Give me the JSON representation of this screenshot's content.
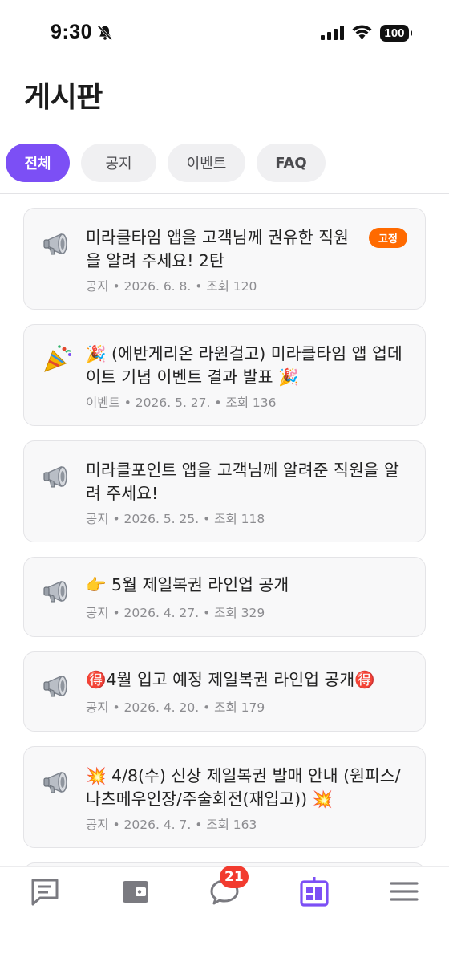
{
  "status": {
    "time": "9:30",
    "battery": "100"
  },
  "page": {
    "title": "게시판"
  },
  "tabs": [
    {
      "label": "전체",
      "active": true
    },
    {
      "label": "공지",
      "active": false
    },
    {
      "label": "이벤트",
      "active": false
    },
    {
      "label": "FAQ",
      "active": false
    }
  ],
  "posts": [
    {
      "icon": "megaphone-icon",
      "title": "미라클타임 앱을 고객님께 권유한 직원을 알려 주세요! 2탄",
      "meta": "공지 • 2026. 6. 8. • 조회 120",
      "pinned_label": "고정"
    },
    {
      "icon": "party-popper-icon",
      "title": "🎉 (에반게리온 라원걸고) 미라클타임 앱 업데이트 기념 이벤트 결과 발표 🎉",
      "meta": "이벤트 • 2026. 5. 27. • 조회 136"
    },
    {
      "icon": "megaphone-icon",
      "title": "미라클포인트 앱을 고객님께 알려준 직원을 알려 주세요!",
      "meta": "공지 • 2026. 5. 25. • 조회 118"
    },
    {
      "icon": "megaphone-icon",
      "title": "👉 5월 제일복권 라인업 공개",
      "meta": "공지 • 2026. 4. 27. • 조회 329"
    },
    {
      "icon": "megaphone-icon",
      "title": "🉐4월 입고 예정 제일복권 라인업 공개🉐",
      "meta": "공지 • 2026. 4. 20. • 조회 179"
    },
    {
      "icon": "megaphone-icon",
      "title": "💥 4/8(수) 신상 제일복권 발매 안내 (원피스/나츠메우인장/주술회전(재입고)) 💥",
      "meta": "공지 • 2026. 4. 7. • 조회 163"
    }
  ],
  "bottom_nav": {
    "items": [
      "chat-icon",
      "wallet-icon",
      "message-icon",
      "board-icon",
      "menu-icon"
    ],
    "message_badge": "21",
    "active": "board-icon"
  },
  "colors": {
    "accent": "#7c4ff5",
    "pin_badge": "#ff6a00",
    "notify_badge": "#f23b2f"
  }
}
